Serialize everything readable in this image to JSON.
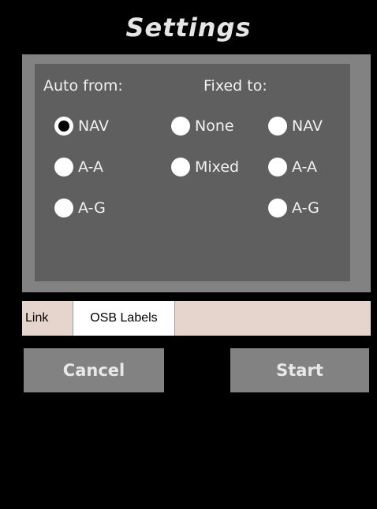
{
  "title": "Settings",
  "auto_from": {
    "header": "Auto from:",
    "options": [
      {
        "label": "NAV",
        "selected": true
      },
      {
        "label": "A-A",
        "selected": false
      },
      {
        "label": "A-G",
        "selected": false
      }
    ]
  },
  "fixed_to": {
    "header": "Fixed to:",
    "col1": [
      {
        "label": "None",
        "selected": false
      },
      {
        "label": "Mixed",
        "selected": false
      }
    ],
    "col2": [
      {
        "label": "NAV",
        "selected": false
      },
      {
        "label": "A-A",
        "selected": false
      },
      {
        "label": "A-G",
        "selected": false
      }
    ]
  },
  "tabs": [
    {
      "label": "Link",
      "active": false
    },
    {
      "label": "OSB Labels",
      "active": true
    }
  ],
  "buttons": {
    "cancel": "Cancel",
    "start": "Start"
  },
  "colors": {
    "background": "#000000",
    "panel_outer": "#828282",
    "panel_inner": "#5f5f5f",
    "tab_strip": "#e6d5cc",
    "button": "#828282"
  }
}
